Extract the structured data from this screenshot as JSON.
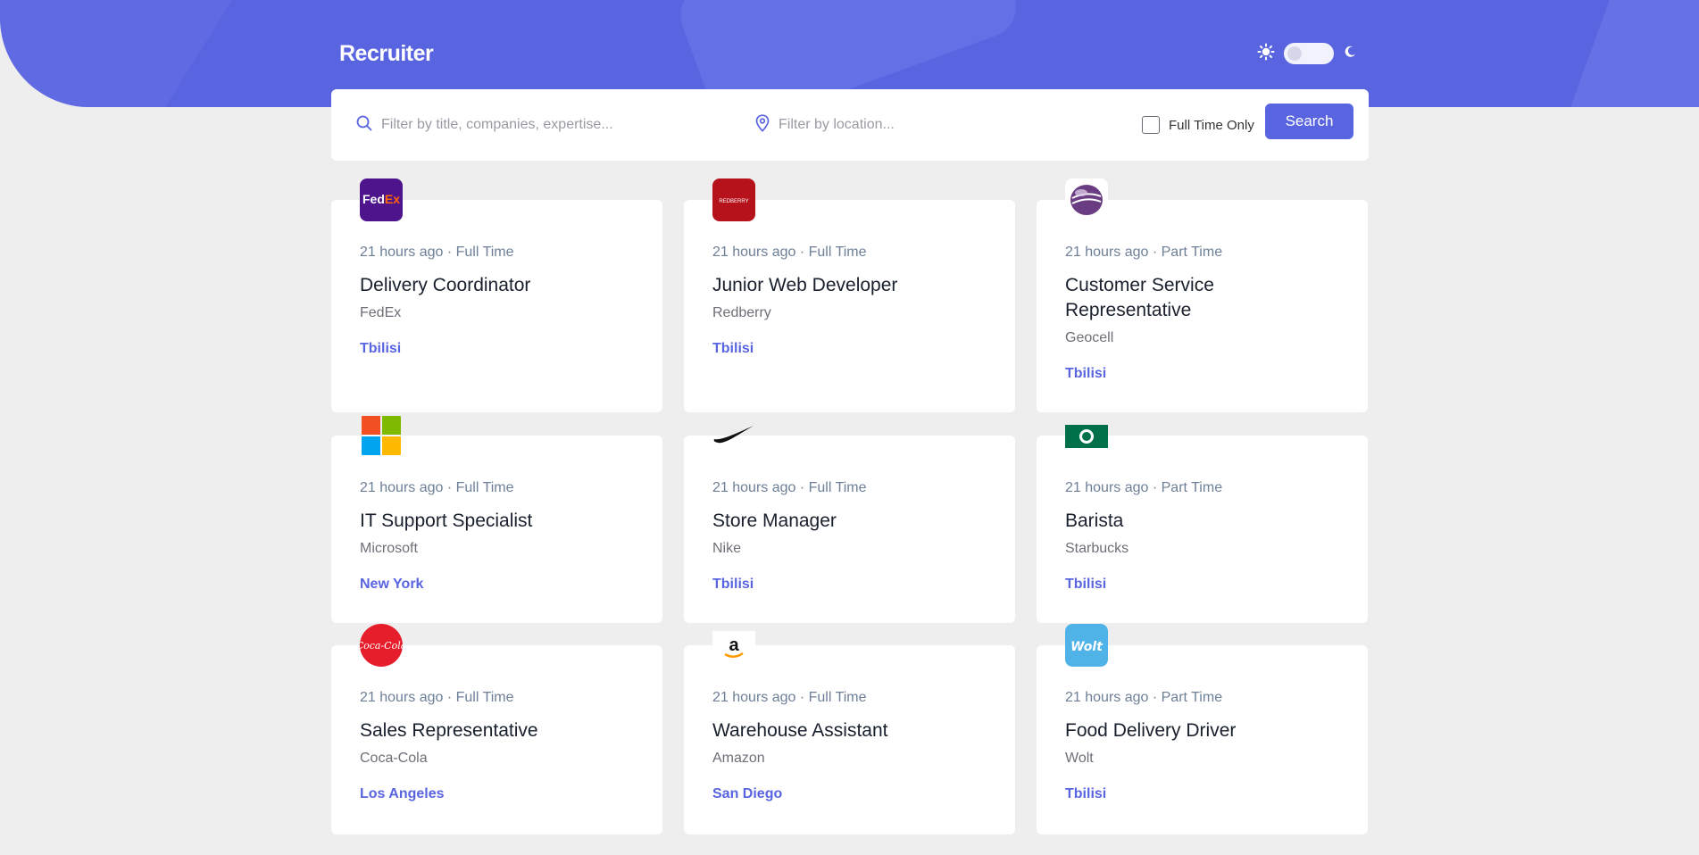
{
  "brand": "Recruiter",
  "theme": {
    "light_icon": "sun-icon",
    "dark_icon": "moon-icon"
  },
  "search": {
    "title_placeholder": "Filter by title, companies, expertise...",
    "location_placeholder": "Filter by location...",
    "fulltime_label": "Full Time Only",
    "button_label": "Search"
  },
  "jobs": [
    {
      "posted": "21 hours ago",
      "type": "Full Time",
      "title": "Delivery Coordinator",
      "company": "FedEx",
      "location": "Tbilisi",
      "logo_text": "FedEx",
      "logo_color": "#4d148c"
    },
    {
      "posted": "21 hours ago",
      "type": "Full Time",
      "title": "Junior Web Developer",
      "company": "Redberry",
      "location": "Tbilisi",
      "logo_text": "REDBERRY",
      "logo_color": "#b5121b"
    },
    {
      "posted": "21 hours ago",
      "type": "Part Time",
      "title": "Customer Service Representative",
      "company": "Geocell",
      "location": "Tbilisi",
      "logo_text": "",
      "logo_color": "#ffffff"
    },
    {
      "posted": "21 hours ago",
      "type": "Full Time",
      "title": "IT Support Specialist",
      "company": "Microsoft",
      "location": "New York",
      "logo_text": "",
      "logo_color": "#ffffff"
    },
    {
      "posted": "21 hours ago",
      "type": "Full Time",
      "title": "Store Manager",
      "company": "Nike",
      "location": "Tbilisi",
      "logo_text": "",
      "logo_color": "#ffffff"
    },
    {
      "posted": "21 hours ago",
      "type": "Part Time",
      "title": "Barista",
      "company": "Starbucks",
      "location": "Tbilisi",
      "logo_text": "",
      "logo_color": "#00704a"
    },
    {
      "posted": "21 hours ago",
      "type": "Full Time",
      "title": "Sales Representative",
      "company": "Coca-Cola",
      "location": "Los Angeles",
      "logo_text": "Coca-Cola",
      "logo_color": "#e61d2b"
    },
    {
      "posted": "21 hours ago",
      "type": "Full Time",
      "title": "Warehouse Assistant",
      "company": "Amazon",
      "location": "San Diego",
      "logo_text": "a",
      "logo_color": "#ffffff"
    },
    {
      "posted": "21 hours ago",
      "type": "Part Time",
      "title": "Food Delivery Driver",
      "company": "Wolt",
      "location": "Tbilisi",
      "logo_text": "Wolt",
      "logo_color": "#4fb3e8"
    }
  ],
  "colors": {
    "accent": "#5964e0",
    "background": "#eeeeee",
    "card": "#ffffff",
    "meta": "#6e8098"
  }
}
